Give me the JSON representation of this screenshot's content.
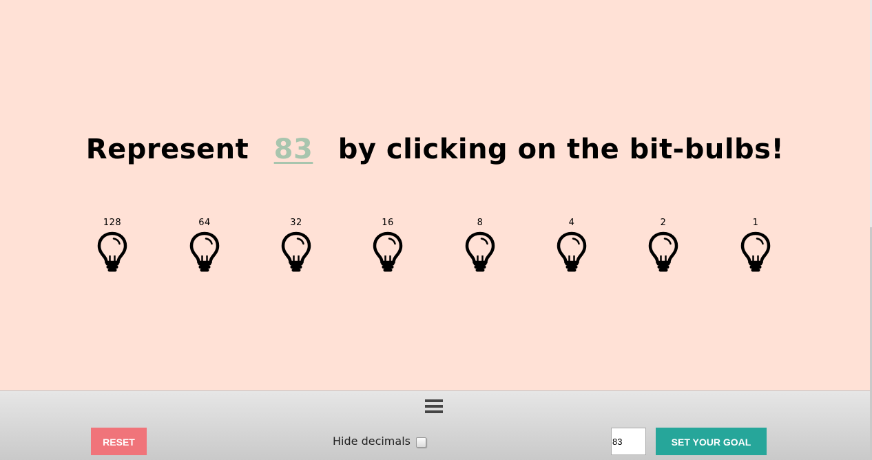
{
  "headline": {
    "prefix": "Represent",
    "goal_value": "83",
    "suffix": "by clicking on the bit-bulbs!"
  },
  "bulbs": [
    {
      "value": "128",
      "on": false
    },
    {
      "value": "64",
      "on": false
    },
    {
      "value": "32",
      "on": false
    },
    {
      "value": "16",
      "on": false
    },
    {
      "value": "8",
      "on": false
    },
    {
      "value": "4",
      "on": false
    },
    {
      "value": "2",
      "on": false
    },
    {
      "value": "1",
      "on": false
    }
  ],
  "footer": {
    "menu_icon": "hamburger-menu-icon",
    "reset_label": "RESET",
    "hide_decimals_label": "Hide decimals",
    "hide_decimals_checked": false,
    "goal_input_value": "83",
    "set_goal_label": "SET YOUR GOAL"
  },
  "colors": {
    "background": "#ffe1d6",
    "goal_number": "#a8c5ae",
    "reset_button": "#f0747a",
    "set_goal_button": "#26a69a",
    "bulb_off": "#000000"
  }
}
